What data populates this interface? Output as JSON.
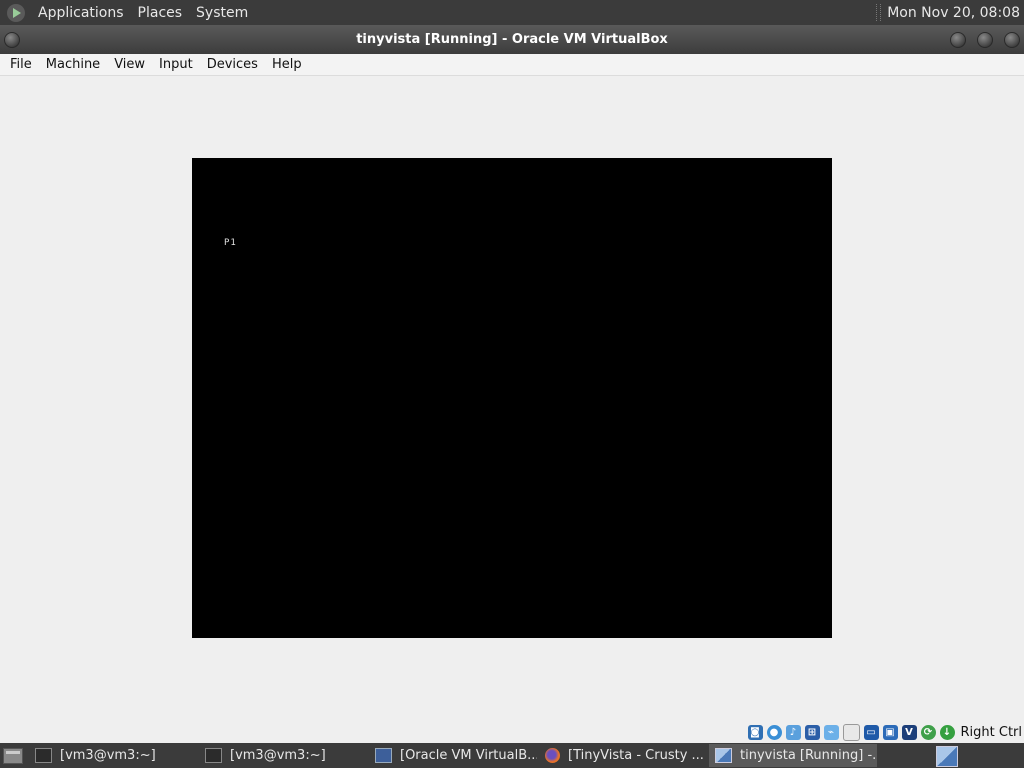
{
  "top_panel": {
    "menus": [
      "Applications",
      "Places",
      "System"
    ],
    "clock": "Mon Nov 20, 08:08"
  },
  "window": {
    "title": "tinyvista [Running] - Oracle VM VirtualBox"
  },
  "menubar": {
    "items": [
      "File",
      "Machine",
      "View",
      "Input",
      "Devices",
      "Help"
    ]
  },
  "vm_screen": {
    "text": "P1"
  },
  "statusbar": {
    "icons": [
      "hard-disk-icon",
      "optical-drive-icon",
      "audio-icon",
      "network-icon",
      "usb-icon",
      "shared-folders-icon",
      "display-icon",
      "recording-icon",
      "vt-x-icon",
      "guest-additions-icon",
      "mouse-integration-icon",
      "host-key-icon"
    ],
    "host_key": "Right Ctrl"
  },
  "taskbar": {
    "tasks": [
      {
        "label": "[vm3@vm3:~]",
        "icon": "terminal-icon",
        "active": false
      },
      {
        "label": "[vm3@vm3:~]",
        "icon": "terminal-icon",
        "active": false
      },
      {
        "label": "[Oracle VM VirtualB...",
        "icon": "virtualbox-icon",
        "active": false
      },
      {
        "label": "[TinyVista - Crusty ...",
        "icon": "firefox-icon",
        "active": false
      },
      {
        "label": "tinyvista [Running] -...",
        "icon": "tinyvista-icon",
        "active": true
      }
    ]
  },
  "colors": {
    "panel_bg": "#3b3b3b",
    "vm_bg": "#000000",
    "window_bg": "#efefef"
  }
}
